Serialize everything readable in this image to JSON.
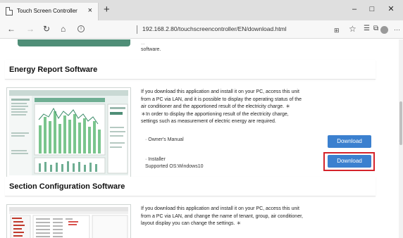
{
  "browser": {
    "tab_title": "Touch Screen Controller",
    "tab_close": "×",
    "new_tab": "+",
    "window_controls": {
      "minimize": "–",
      "maximize": "□",
      "close": "✕"
    },
    "url": "192.168.2.80/touchscreencontroller/EN/download.html",
    "icons": [
      "back-icon",
      "forward-icon",
      "refresh-icon",
      "home-icon",
      "info-icon",
      "reading-view-icon",
      "favorites-star-icon",
      "favorites-bar-icon",
      "collections-icon",
      "profile-icon",
      "more-icon"
    ]
  },
  "page": {
    "prev_section_text": "software.",
    "prev_section_faded": "...",
    "sections": [
      {
        "title": "Energy Report Software",
        "description": [
          "If you download this application and install it on your PC, access this unit",
          "from a PC via LAN, and it is possible to display the operating status of the",
          "air conditioner and the apportioned result of the electricity charge. ＊",
          "＊In order to display the apportioning result of the electricity charge,",
          "settings such as measurement of electric energy are required."
        ],
        "items": [
          {
            "label": "· Owner's Manual",
            "sublabel": "",
            "button": "Download"
          },
          {
            "label": "· Installer",
            "sublabel": "Supported OS:Windows10",
            "button": "Download"
          }
        ]
      },
      {
        "title": "Section Configuration Software",
        "description": [
          "If you download this application and install it on your PC, access this unit",
          "from a PC via LAN, and change the name of tenant, group, air conditioner,",
          "layout display you can change the settings. ＊"
        ]
      }
    ]
  },
  "colors": {
    "download_button": "#3b80cf",
    "highlight": "#d4232b",
    "chart_green": "#4f8e77"
  }
}
